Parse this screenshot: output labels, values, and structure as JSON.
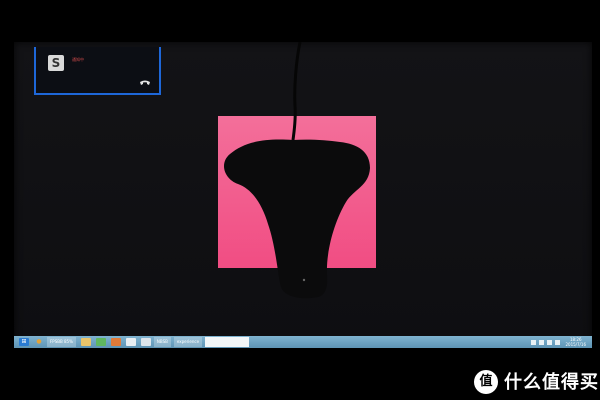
{
  "toast": {
    "app_icon_glyph": "S",
    "text": "通知中",
    "action_icon": "phone-icon"
  },
  "taskbar": {
    "icons": [
      {
        "name": "windows-start-icon",
        "glyph": "⊞",
        "color": "#2b7cd3"
      },
      {
        "name": "chrome-icon",
        "glyph": "●",
        "color": "#e2a33a"
      }
    ],
    "tasks": [
      {
        "label": "FPSBB 85%",
        "active": false
      },
      {
        "label": "",
        "active": false
      },
      {
        "label": "",
        "active": false
      },
      {
        "label": "",
        "active": false
      },
      {
        "label": "",
        "active": false
      },
      {
        "label": "",
        "active": false
      },
      {
        "label": "NBSB",
        "active": false
      },
      {
        "label": "experience",
        "active": false
      },
      {
        "label": "",
        "active": true
      }
    ],
    "clock_time": "18:26",
    "clock_date": "2015/7/16"
  },
  "watermark": {
    "logo_glyph": "值",
    "text": "什么值得买"
  },
  "colors": {
    "pink_window": "#f36f9a",
    "taskbar": "#7fb3d0",
    "toast_border": "#1e67d8"
  }
}
